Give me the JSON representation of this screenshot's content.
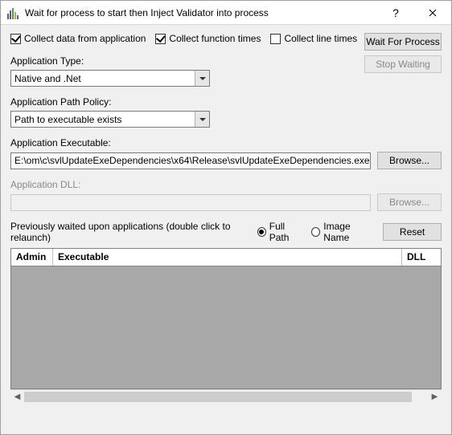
{
  "window": {
    "title": "Wait for process to start then Inject Validator into process"
  },
  "checks": {
    "collect_data": {
      "label": "Collect data from application",
      "checked": true
    },
    "collect_func": {
      "label": "Collect function times",
      "checked": true
    },
    "collect_line": {
      "label": "Collect line times",
      "checked": false
    }
  },
  "buttons": {
    "wait": "Wait For Process",
    "stop": "Stop Waiting",
    "browse1": "Browse...",
    "browse2": "Browse...",
    "reset": "Reset"
  },
  "labels": {
    "app_type": "Application Type:",
    "path_policy": "Application Path Policy:",
    "app_exe": "Application Executable:",
    "app_dll": "Application DLL:",
    "prev": "Previously waited upon applications (double click to relaunch)"
  },
  "combos": {
    "app_type": "Native and .Net",
    "path_policy": "Path to executable exists"
  },
  "inputs": {
    "exe": "E:\\om\\c\\svlUpdateExeDependencies\\x64\\Release\\svlUpdateExeDependencies.exe",
    "dll": ""
  },
  "radios": {
    "full_path": "Full Path",
    "image_name": "Image Name",
    "selected": "full_path"
  },
  "table": {
    "columns": [
      "Admin",
      "Executable",
      "DLL"
    ],
    "rows": []
  }
}
